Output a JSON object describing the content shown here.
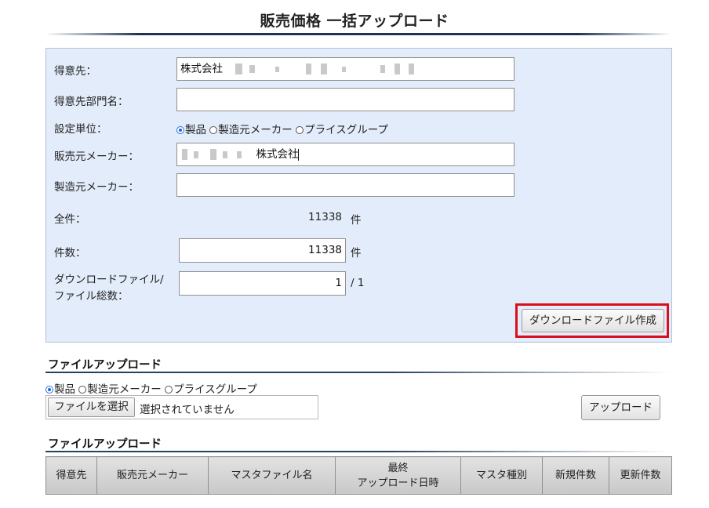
{
  "page": {
    "title": "販売価格 一括アップロード"
  },
  "form": {
    "customer": {
      "label": "得意先：",
      "value": "株式会社"
    },
    "customer_dept": {
      "label": "得意先部門名：",
      "value": ""
    },
    "unit": {
      "label": "設定単位：",
      "options": [
        "製品",
        "製造元メーカー",
        "プライスグループ"
      ],
      "selected": "製品"
    },
    "seller": {
      "label": "販売元メーカー：",
      "value": "株式会社"
    },
    "maker": {
      "label": "製造元メーカー：",
      "value": ""
    },
    "total": {
      "label": "全件：",
      "value": "11338",
      "unit": "件"
    },
    "count": {
      "label": "件数：",
      "value": "11338",
      "unit": "件"
    },
    "files": {
      "label_line1": "ダウンロードファイル/",
      "label_line2": "ファイル総数：",
      "value": "1",
      "suffix": "/ 1"
    },
    "create_button": "ダウンロードファイル作成"
  },
  "upload": {
    "heading": "ファイルアップロード",
    "options": [
      "製品",
      "製造元メーカー",
      "プライスグループ"
    ],
    "selected": "製品",
    "choose_button": "ファイルを選択",
    "no_file_text": "選択されていません",
    "upload_button": "アップロード"
  },
  "history": {
    "heading": "ファイルアップロード",
    "columns": [
      "得意先",
      "販売元メーカー",
      "マスタファイル名",
      "最終",
      "アップロード日時",
      "マスタ種別",
      "新規件数",
      "更新件数"
    ]
  }
}
